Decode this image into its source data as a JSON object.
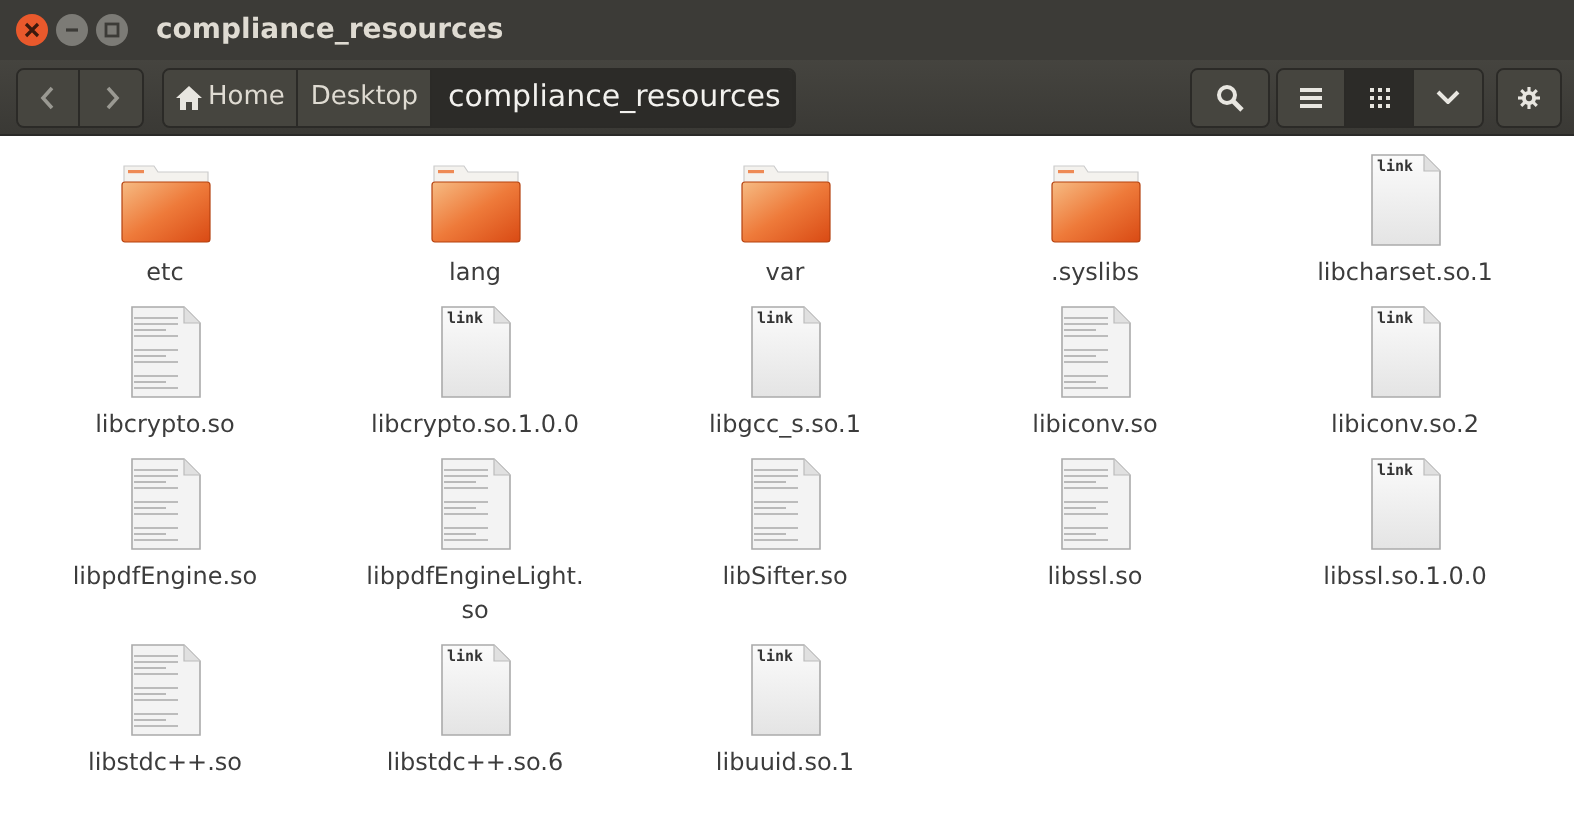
{
  "window": {
    "title": "compliance_resources"
  },
  "breadcrumbs": [
    {
      "label": "Home",
      "kind": "home",
      "selected": false
    },
    {
      "label": "Desktop",
      "kind": "folder",
      "selected": false
    },
    {
      "label": "compliance_resources",
      "kind": "folder",
      "selected": true
    }
  ],
  "view_buttons": [
    {
      "kind": "list",
      "selected": false
    },
    {
      "kind": "grid",
      "selected": true
    },
    {
      "kind": "dropdown",
      "selected": false
    }
  ],
  "files": [
    {
      "name": "etc",
      "kind": "folder"
    },
    {
      "name": "lang",
      "kind": "folder"
    },
    {
      "name": "var",
      "kind": "folder"
    },
    {
      "name": ".syslibs",
      "kind": "folder"
    },
    {
      "name": "libcharset.so.1",
      "kind": "link",
      "emblem": "link"
    },
    {
      "name": "libcrypto.so",
      "kind": "file"
    },
    {
      "name": "libcrypto.so.1.0.0",
      "kind": "link",
      "emblem": "link"
    },
    {
      "name": "libgcc_s.so.1",
      "kind": "link",
      "emblem": "link"
    },
    {
      "name": "libiconv.so",
      "kind": "file"
    },
    {
      "name": "libiconv.so.2",
      "kind": "link",
      "emblem": "link"
    },
    {
      "name": "libpdfEngine.so",
      "kind": "file"
    },
    {
      "name": "libpdfEngineLight.so",
      "kind": "file"
    },
    {
      "name": "libSifter.so",
      "kind": "file"
    },
    {
      "name": "libssl.so",
      "kind": "file"
    },
    {
      "name": "libssl.so.1.0.0",
      "kind": "link",
      "emblem": "link"
    },
    {
      "name": "libstdc++.so",
      "kind": "file"
    },
    {
      "name": "libstdc++.so.6",
      "kind": "link",
      "emblem": "link"
    },
    {
      "name": "libuuid.so.1",
      "kind": "link",
      "emblem": "link"
    }
  ]
}
